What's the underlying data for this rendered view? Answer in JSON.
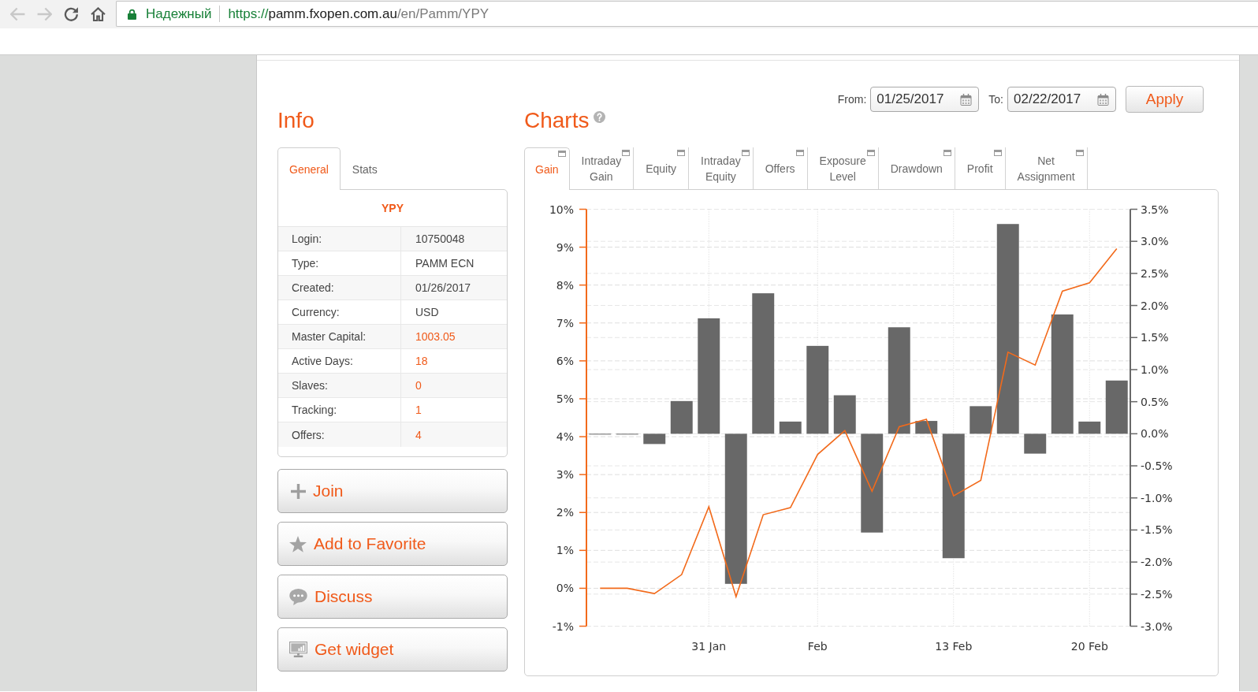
{
  "browser": {
    "nav_buttons": [
      {
        "kind": "back",
        "disabled": true
      },
      {
        "kind": "forward",
        "disabled": true
      },
      {
        "kind": "reload",
        "disabled": false
      },
      {
        "kind": "home",
        "disabled": false
      }
    ],
    "security_label": "Надежный",
    "url": {
      "scheme": "https://",
      "host": "pamm.fxopen.com.au",
      "path": "/en/Pamm/YPY"
    }
  },
  "info": {
    "title": "Info",
    "tabs": [
      {
        "label": "General",
        "selected": true
      },
      {
        "label": "Stats",
        "selected": false
      }
    ],
    "account_name": "YPY",
    "rows": [
      {
        "label": "Login:",
        "value": "10750048",
        "highlighted": false
      },
      {
        "label": "Type:",
        "value": "PAMM ECN",
        "highlighted": false
      },
      {
        "label": "Created:",
        "value": "01/26/2017",
        "highlighted": false
      },
      {
        "label": "Currency:",
        "value": "USD",
        "highlighted": false
      },
      {
        "label": "Master Capital:",
        "value": "1003.05",
        "highlighted": true
      },
      {
        "label": "Active Days:",
        "value": "18",
        "highlighted": true
      },
      {
        "label": "Slaves:",
        "value": "0",
        "highlighted": true
      },
      {
        "label": "Tracking:",
        "value": "1",
        "highlighted": true
      },
      {
        "label": "Offers:",
        "value": "4",
        "highlighted": true
      }
    ],
    "buttons": [
      {
        "kind": "join",
        "label": "Join"
      },
      {
        "kind": "favorite",
        "label": "Add to Favorite"
      },
      {
        "kind": "discuss",
        "label": "Discuss"
      },
      {
        "kind": "widget",
        "label": "Get widget"
      }
    ]
  },
  "charts": {
    "title": "Charts",
    "date_from": {
      "label": "From:",
      "value": "01/25/2017"
    },
    "date_to": {
      "label": "To:",
      "value": "02/22/2017"
    },
    "apply_button": "Apply",
    "tabs": [
      {
        "label": "Gain",
        "selected": true
      },
      {
        "label": "Intraday Gain",
        "selected": false
      },
      {
        "label": "Equity",
        "selected": false
      },
      {
        "label": "Intraday Equity",
        "selected": false
      },
      {
        "label": "Offers",
        "selected": false
      },
      {
        "label": "Exposure Level",
        "selected": false
      },
      {
        "label": "Drawdown",
        "selected": false
      },
      {
        "label": "Profit",
        "selected": false
      },
      {
        "label": "Net Assignment",
        "selected": false
      }
    ],
    "chart_data": [
      {
        "type": "bar",
        "categories": [
          null,
          null,
          null,
          null,
          "31 Jan",
          null,
          null,
          null,
          "Feb",
          null,
          null,
          null,
          null,
          "13 Feb",
          null,
          null,
          null,
          null,
          "20 Feb",
          null
        ],
        "series": [
          {
            "axis": "y2",
            "color": "#686868",
            "values": [
              0,
              0,
              -0.16,
              0.51,
              1.8,
              -2.34,
              2.19,
              0.19,
              1.37,
              0.6,
              -1.54,
              1.66,
              0.2,
              -1.94,
              0.43,
              3.27,
              -0.31,
              1.86,
              0.19,
              0.83
            ]
          },
          {
            "type": "line",
            "color": "#f26a1b",
            "values": [
              0,
              0,
              -0.14,
              0.36,
              2.15,
              -0.22,
              1.94,
              2.13,
              3.53,
              4.16,
              2.56,
              4.26,
              4.46,
              2.44,
              2.85,
              6.23,
              5.89,
              7.84,
              8.06,
              8.96
            ]
          }
        ],
        "ylim": [
          -1,
          10
        ],
        "yticks": [
          {
            "value": -1,
            "label": "-1%"
          },
          {
            "value": 0,
            "label": "0%"
          },
          {
            "value": 1,
            "label": "1%"
          },
          {
            "value": 2,
            "label": "2%"
          },
          {
            "value": 3,
            "label": "3%"
          },
          {
            "value": 4,
            "label": "4%"
          },
          {
            "value": 5,
            "label": "5%"
          },
          {
            "value": 6,
            "label": "6%"
          },
          {
            "value": 7,
            "label": "7%"
          },
          {
            "value": 8,
            "label": "8%"
          },
          {
            "value": 9,
            "label": "9%"
          },
          {
            "value": 10,
            "label": "10%"
          }
        ],
        "y2lim": [
          -3,
          3.5
        ],
        "y2ticks": [
          {
            "value": -3,
            "label": "-3.0%"
          },
          {
            "value": -2.5,
            "label": "-2.5%"
          },
          {
            "value": -2,
            "label": "-2.0%"
          },
          {
            "value": -1.5,
            "label": "-1.5%"
          },
          {
            "value": -1,
            "label": "-1.0%"
          },
          {
            "value": -0.5,
            "label": "-0.5%"
          },
          {
            "value": 0,
            "label": "0.0%"
          },
          {
            "value": 0.5,
            "label": "0.5%"
          },
          {
            "value": 1,
            "label": "1.0%"
          },
          {
            "value": 1.5,
            "label": "1.5%"
          },
          {
            "value": 2,
            "label": "2.0%"
          },
          {
            "value": 2.5,
            "label": "2.5%"
          },
          {
            "value": 3,
            "label": "3.0%"
          },
          {
            "value": 3.5,
            "label": "3.5%"
          }
        ],
        "grid": true
      }
    ]
  }
}
